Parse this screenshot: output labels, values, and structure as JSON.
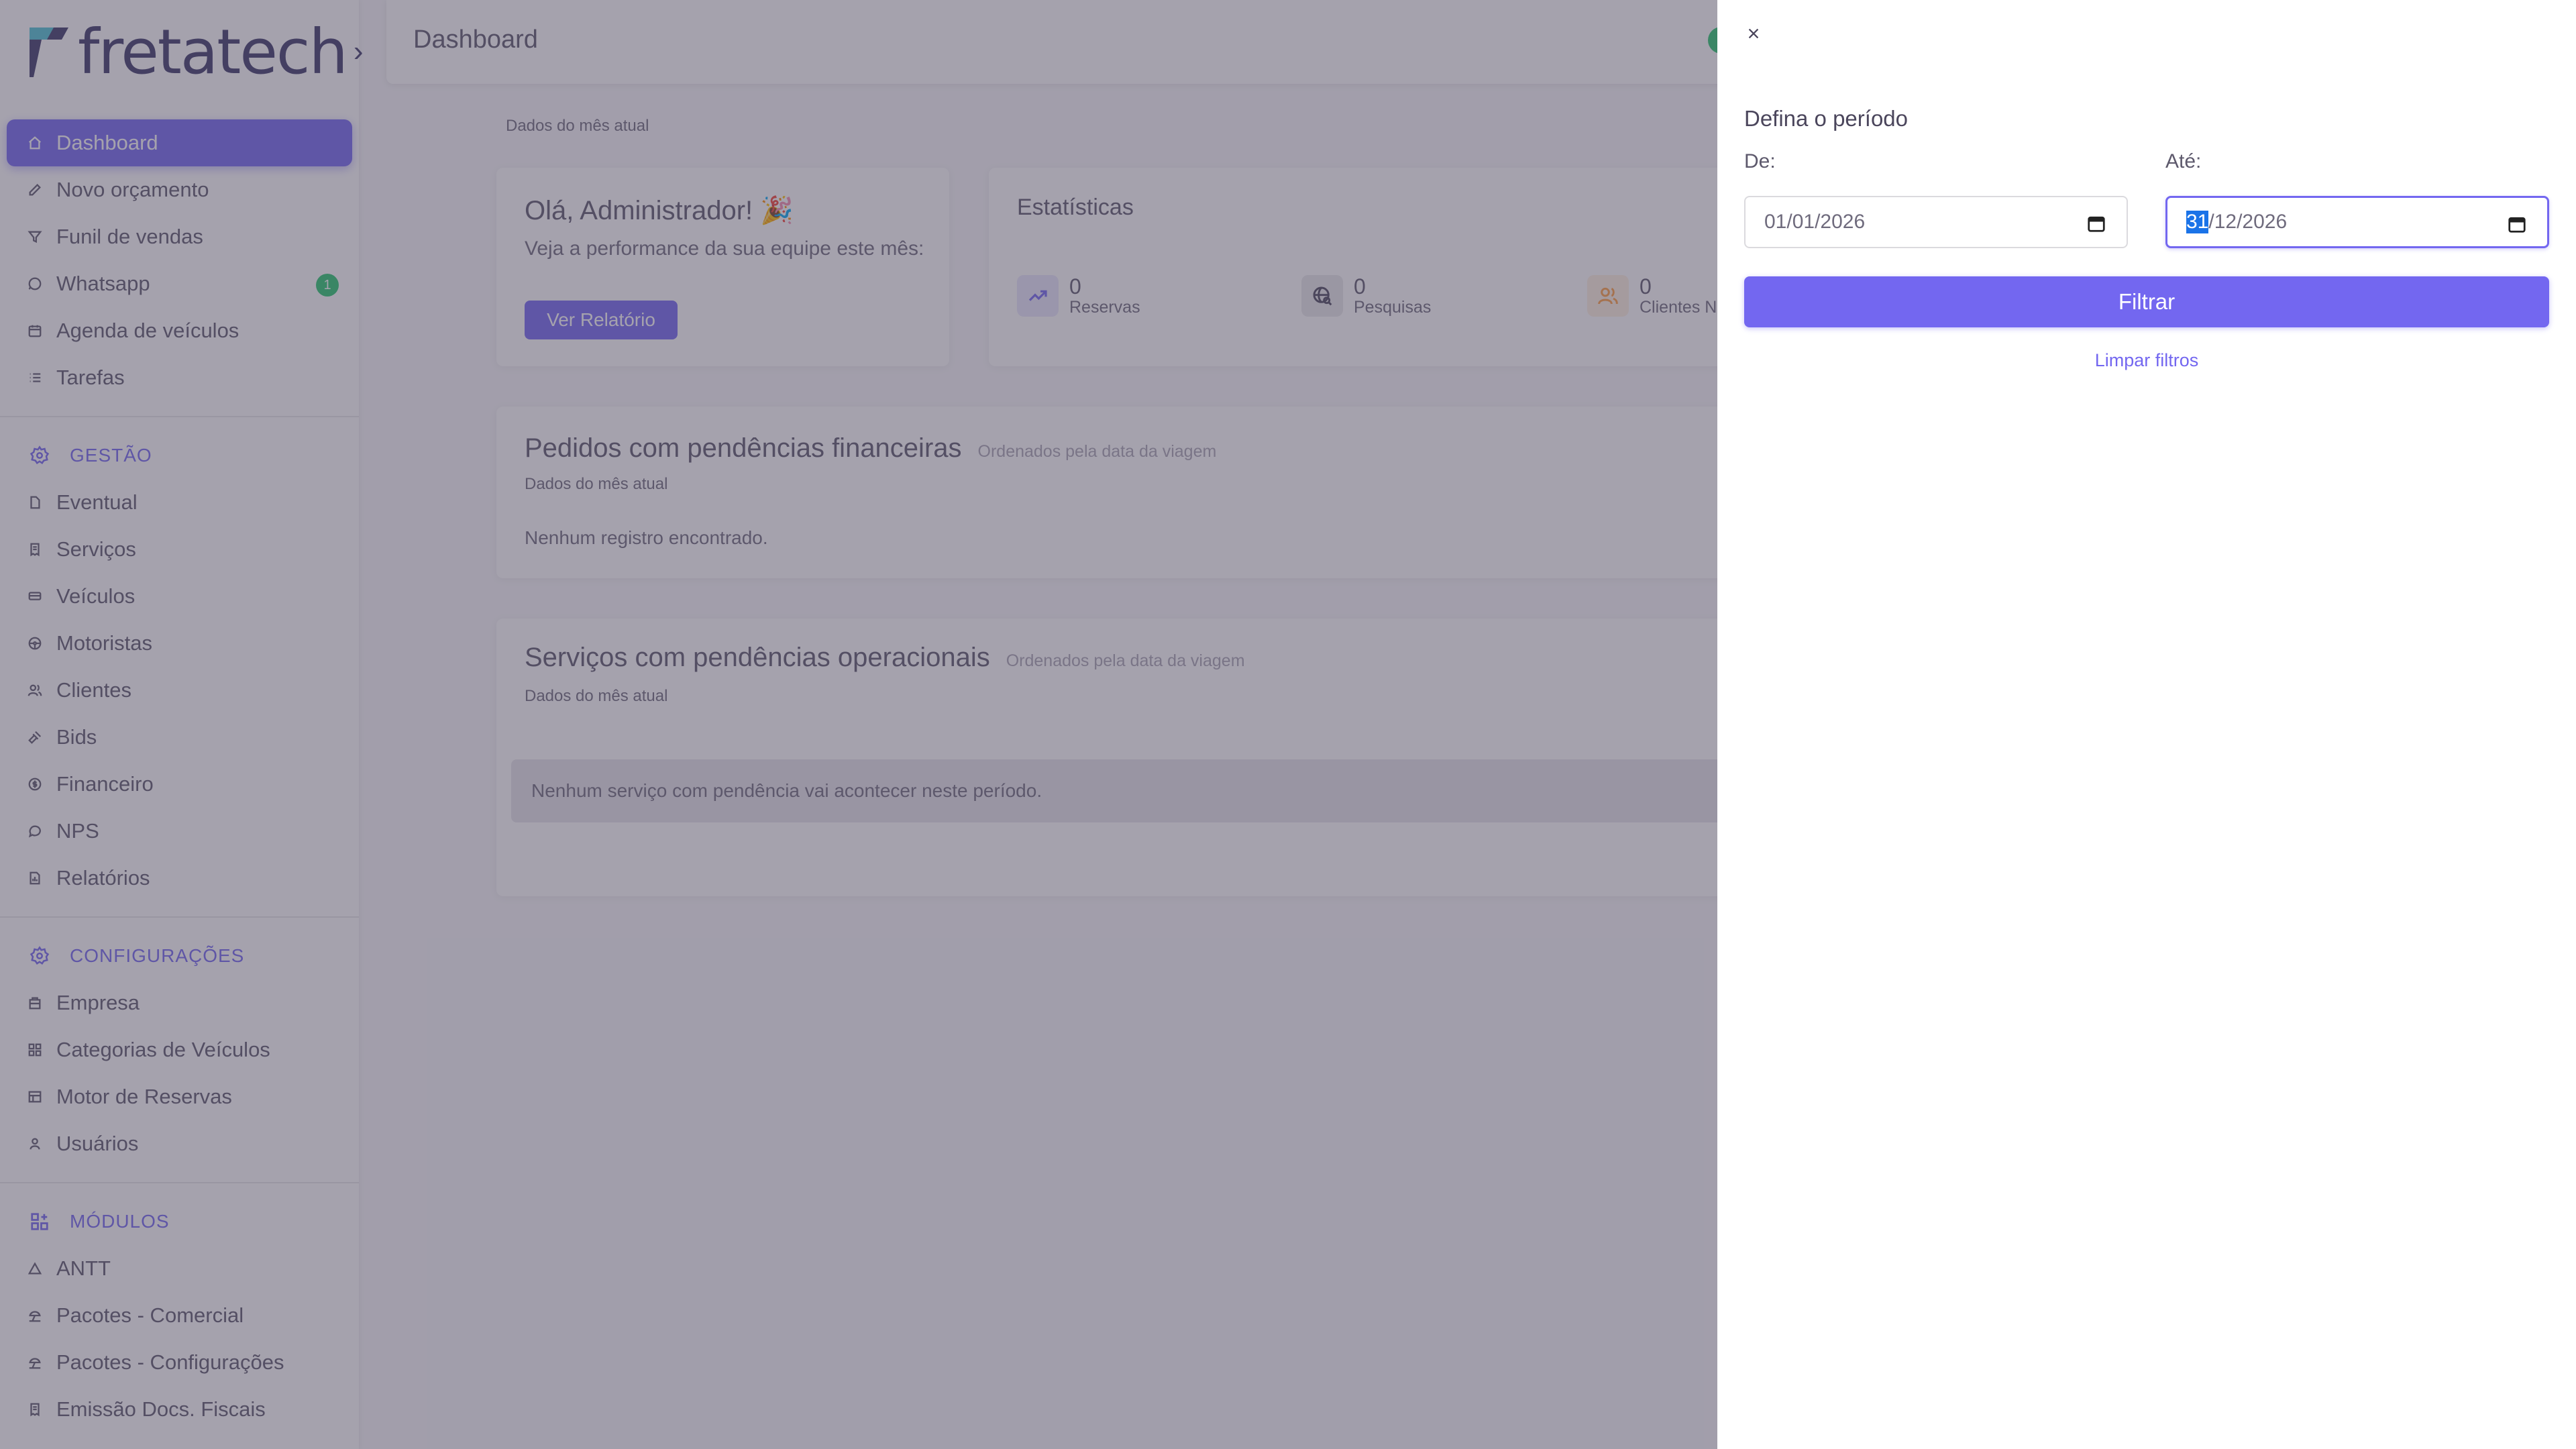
{
  "brand": {
    "name": "fretatech"
  },
  "sidebar": {
    "items": [
      {
        "label": "Dashboard",
        "icon": "home-icon",
        "active": true
      },
      {
        "label": "Novo orçamento",
        "icon": "edit-icon"
      },
      {
        "label": "Funil de vendas",
        "icon": "funnel-icon"
      },
      {
        "label": "Whatsapp",
        "icon": "whatsapp-icon",
        "badge": "1"
      },
      {
        "label": "Agenda de veículos",
        "icon": "calendar-icon"
      },
      {
        "label": "Tarefas",
        "icon": "list-icon"
      }
    ],
    "sections": [
      {
        "title": "GESTÃO",
        "items": [
          {
            "label": "Eventual",
            "icon": "file-icon"
          },
          {
            "label": "Serviços",
            "icon": "receipt-icon"
          },
          {
            "label": "Veículos",
            "icon": "bus-icon"
          },
          {
            "label": "Motoristas",
            "icon": "steering-wheel-icon"
          },
          {
            "label": "Clientes",
            "icon": "users-icon"
          },
          {
            "label": "Bids",
            "icon": "gavel-icon"
          },
          {
            "label": "Financeiro",
            "icon": "coin-icon"
          },
          {
            "label": "NPS",
            "icon": "chat-icon"
          },
          {
            "label": "Relatórios",
            "icon": "report-icon"
          }
        ]
      },
      {
        "title": "CONFIGURAÇÕES",
        "items": [
          {
            "label": "Empresa",
            "icon": "building-icon"
          },
          {
            "label": "Categorias de Veículos",
            "icon": "category-icon"
          },
          {
            "label": "Motor de Reservas",
            "icon": "table-icon"
          },
          {
            "label": "Usuários",
            "icon": "user-icon"
          }
        ]
      },
      {
        "title": "MÓDULOS",
        "items": [
          {
            "label": "ANTT",
            "icon": "triangle-icon"
          },
          {
            "label": "Pacotes - Comercial",
            "icon": "beach-icon"
          },
          {
            "label": "Pacotes - Configurações",
            "icon": "beach-icon"
          },
          {
            "label": "Emissão Docs. Fiscais",
            "icon": "receipt-icon"
          }
        ]
      }
    ]
  },
  "header": {
    "title": "Dashboard"
  },
  "main": {
    "period_caption": "Dados do mês atual",
    "welcome": {
      "title": "Olá, Administrador! 🎉",
      "text": "Veja a performance da sua equipe este mês:",
      "button": "Ver Relatório"
    },
    "stats": {
      "title": "Estatísticas",
      "items": [
        {
          "value": "0",
          "label": "Reservas",
          "icon": "trending-up-icon",
          "color": "#7367f0"
        },
        {
          "value": "0",
          "label": "Pesquisas",
          "icon": "world-search-icon",
          "color": "#4b465c"
        },
        {
          "value": "0",
          "label": "Clientes N",
          "icon": "users-icon",
          "color": "#ff9f43"
        }
      ]
    },
    "financial": {
      "title": "Pedidos com pendências financeiras",
      "subtitle": "Ordenados pela data da viagem",
      "caption": "Dados do mês atual",
      "empty": "Nenhum registro encontrado."
    },
    "operational": {
      "title": "Serviços com pendências operacionais",
      "subtitle": "Ordenados pela data da viagem",
      "caption": "Dados do mês atual",
      "empty": "Nenhum serviço com pendência vai acontecer neste período."
    }
  },
  "drawer": {
    "title": "Defina o período",
    "from_label": "De:",
    "to_label": "Até:",
    "from_value": "01/01/2026",
    "to_value_day": "31",
    "to_value_rest": "/12/2026",
    "filter_button": "Filtrar",
    "clear_link": "Limpar filtros"
  },
  "colors": {
    "primary": "#7367f0",
    "success": "#28c76f",
    "warning": "#ff9f43"
  }
}
